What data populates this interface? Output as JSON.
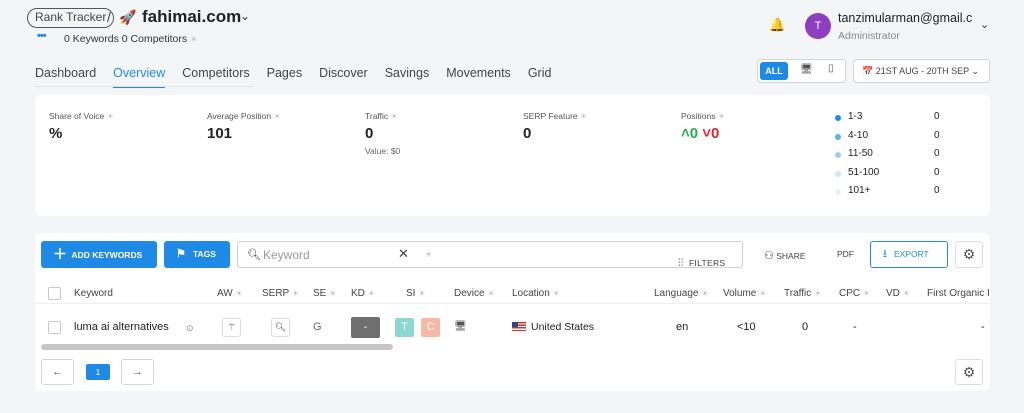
{
  "header": {
    "brand": "Rank Tracker",
    "separator": "/",
    "domain": "fahimai.com",
    "keywords_count": "0 Keywords",
    "competitors_count": "0 Competitors"
  },
  "user": {
    "initial": "T",
    "email": "tanzimularman@gmail.c...",
    "role": "Administrator",
    "avatar_color": "#8e3ec1"
  },
  "nav": {
    "tabs": [
      "Dashboard",
      "Overview",
      "Competitors",
      "Pages",
      "Discover",
      "Savings",
      "Movements",
      "Grid"
    ],
    "active": "Overview"
  },
  "device_filter": {
    "all_label": "ALL"
  },
  "date_range": "21ST AUG - 20TH SEP",
  "stats": {
    "share_of_voice": {
      "label": "Share of Voice",
      "value": "%"
    },
    "average_position": {
      "label": "Average Position",
      "value": "101"
    },
    "traffic": {
      "label": "Traffic",
      "value": "0",
      "sub": "Value: $0"
    },
    "serp_feature": {
      "label": "SERP Feature",
      "value": "0"
    },
    "positions": {
      "label": "Positions",
      "up": "0",
      "down": "0"
    }
  },
  "distribution": [
    {
      "label": "1-3",
      "value": "0",
      "color": "#1f8ae5"
    },
    {
      "label": "4-10",
      "value": "0",
      "color": "#5fb0ee"
    },
    {
      "label": "11-50",
      "value": "0",
      "color": "#9ccdf4"
    },
    {
      "label": "51-100",
      "value": "0",
      "color": "#cfe6f9"
    },
    {
      "label": "101+",
      "value": "0",
      "color": "#e8f3fc"
    }
  ],
  "toolbar": {
    "add_keywords": "ADD KEYWORDS",
    "tags": "TAGS",
    "search_placeholder": "Keyword",
    "filters": "FILTERS",
    "share": "SHARE",
    "pdf": "PDF",
    "export": "EXPORT"
  },
  "table": {
    "columns": [
      "Keyword",
      "AW",
      "SERP",
      "SE",
      "KD",
      "SI",
      "Device",
      "Location",
      "Language",
      "Volume",
      "Traffic",
      "CPC",
      "VD",
      "First Organic I"
    ],
    "rows": [
      {
        "keyword": "luma ai alternatives",
        "se": "G",
        "kd": "-",
        "si_t": "T",
        "si_c": "C",
        "location": "United States",
        "language": "en",
        "volume": "<10",
        "traffic": "0",
        "cpc": "-",
        "first_organic": "-"
      }
    ]
  },
  "pagination": {
    "current": "1",
    "prev": "←",
    "next": "→"
  }
}
